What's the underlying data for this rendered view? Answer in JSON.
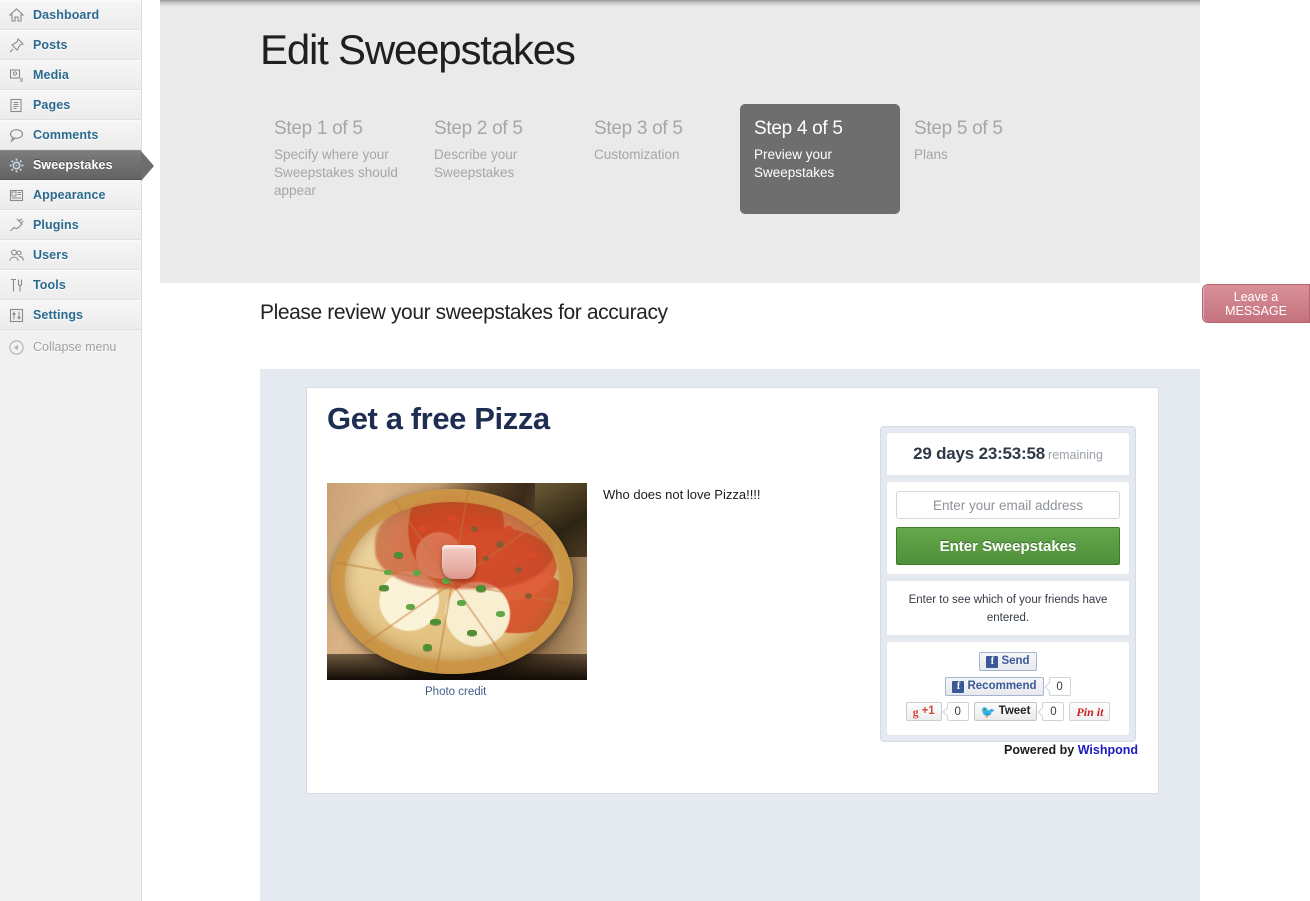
{
  "sidebar": {
    "items": [
      {
        "label": "Dashboard",
        "icon": "home-icon",
        "active": false
      },
      {
        "label": "Posts",
        "icon": "pin-icon",
        "active": false
      },
      {
        "label": "Media",
        "icon": "media-icon",
        "active": false
      },
      {
        "label": "Pages",
        "icon": "pages-icon",
        "active": false
      },
      {
        "label": "Comments",
        "icon": "comment-bubble-icon",
        "active": false
      },
      {
        "label": "Sweepstakes",
        "icon": "gear-icon",
        "active": true
      },
      {
        "label": "Appearance",
        "icon": "appearance-icon",
        "active": false
      },
      {
        "label": "Plugins",
        "icon": "plug-icon",
        "active": false
      },
      {
        "label": "Users",
        "icon": "users-icon",
        "active": false
      },
      {
        "label": "Tools",
        "icon": "tools-icon",
        "active": false
      },
      {
        "label": "Settings",
        "icon": "sliders-icon",
        "active": false
      }
    ],
    "collapse_label": "Collapse menu"
  },
  "header": {
    "title": "Edit Sweepstakes",
    "steps": [
      {
        "num": "Step 1 of 5",
        "desc": "Specify where your Sweepstakes should appear",
        "current": false
      },
      {
        "num": "Step 2 of 5",
        "desc": "Describe your Sweepstakes",
        "current": false
      },
      {
        "num": "Step 3 of 5",
        "desc": "Customization",
        "current": false
      },
      {
        "num": "Step 4 of 5",
        "desc": "Preview your Sweepstakes",
        "current": true
      },
      {
        "num": "Step 5 of 5",
        "desc": "Plans",
        "current": false
      }
    ]
  },
  "review_line": "Please review your sweepstakes for accuracy",
  "promo": {
    "title": "Get a free Pizza",
    "body": "Who does not love Pizza!!!!",
    "photo_credit": "Photo credit",
    "photo_alt": "Pizza in an open cardboard box with a plastic cup in the center"
  },
  "widget": {
    "countdown_time": "29 days 23:53:58",
    "countdown_remaining": "remaining",
    "email_placeholder": "Enter your email address",
    "enter_button": "Enter Sweepstakes",
    "friends_text": "Enter to see which of your friends have entered.",
    "social": {
      "fb_send": "Send",
      "fb_recommend": "Recommend",
      "fb_recommend_count": "0",
      "gplus_label": "+1",
      "gplus_count": "0",
      "tweet_label": "Tweet",
      "tweet_count": "0",
      "pinit_label": "Pin it"
    },
    "powered_prefix": "Powered by",
    "powered_brand": "Wishpond"
  },
  "leave_message": {
    "line1": "Leave a",
    "line2": "MESSAGE"
  },
  "colors": {
    "accent_blue": "#2b6a8f",
    "active_gray": "#6e6e6e",
    "header_bg": "#eaeaea",
    "widget_bg": "#e5eaf1",
    "green_button": "#4f8f3a",
    "promo_title": "#1e2d52",
    "wishpond_link": "#1b1bbf",
    "message_tab": "#c4737f"
  }
}
